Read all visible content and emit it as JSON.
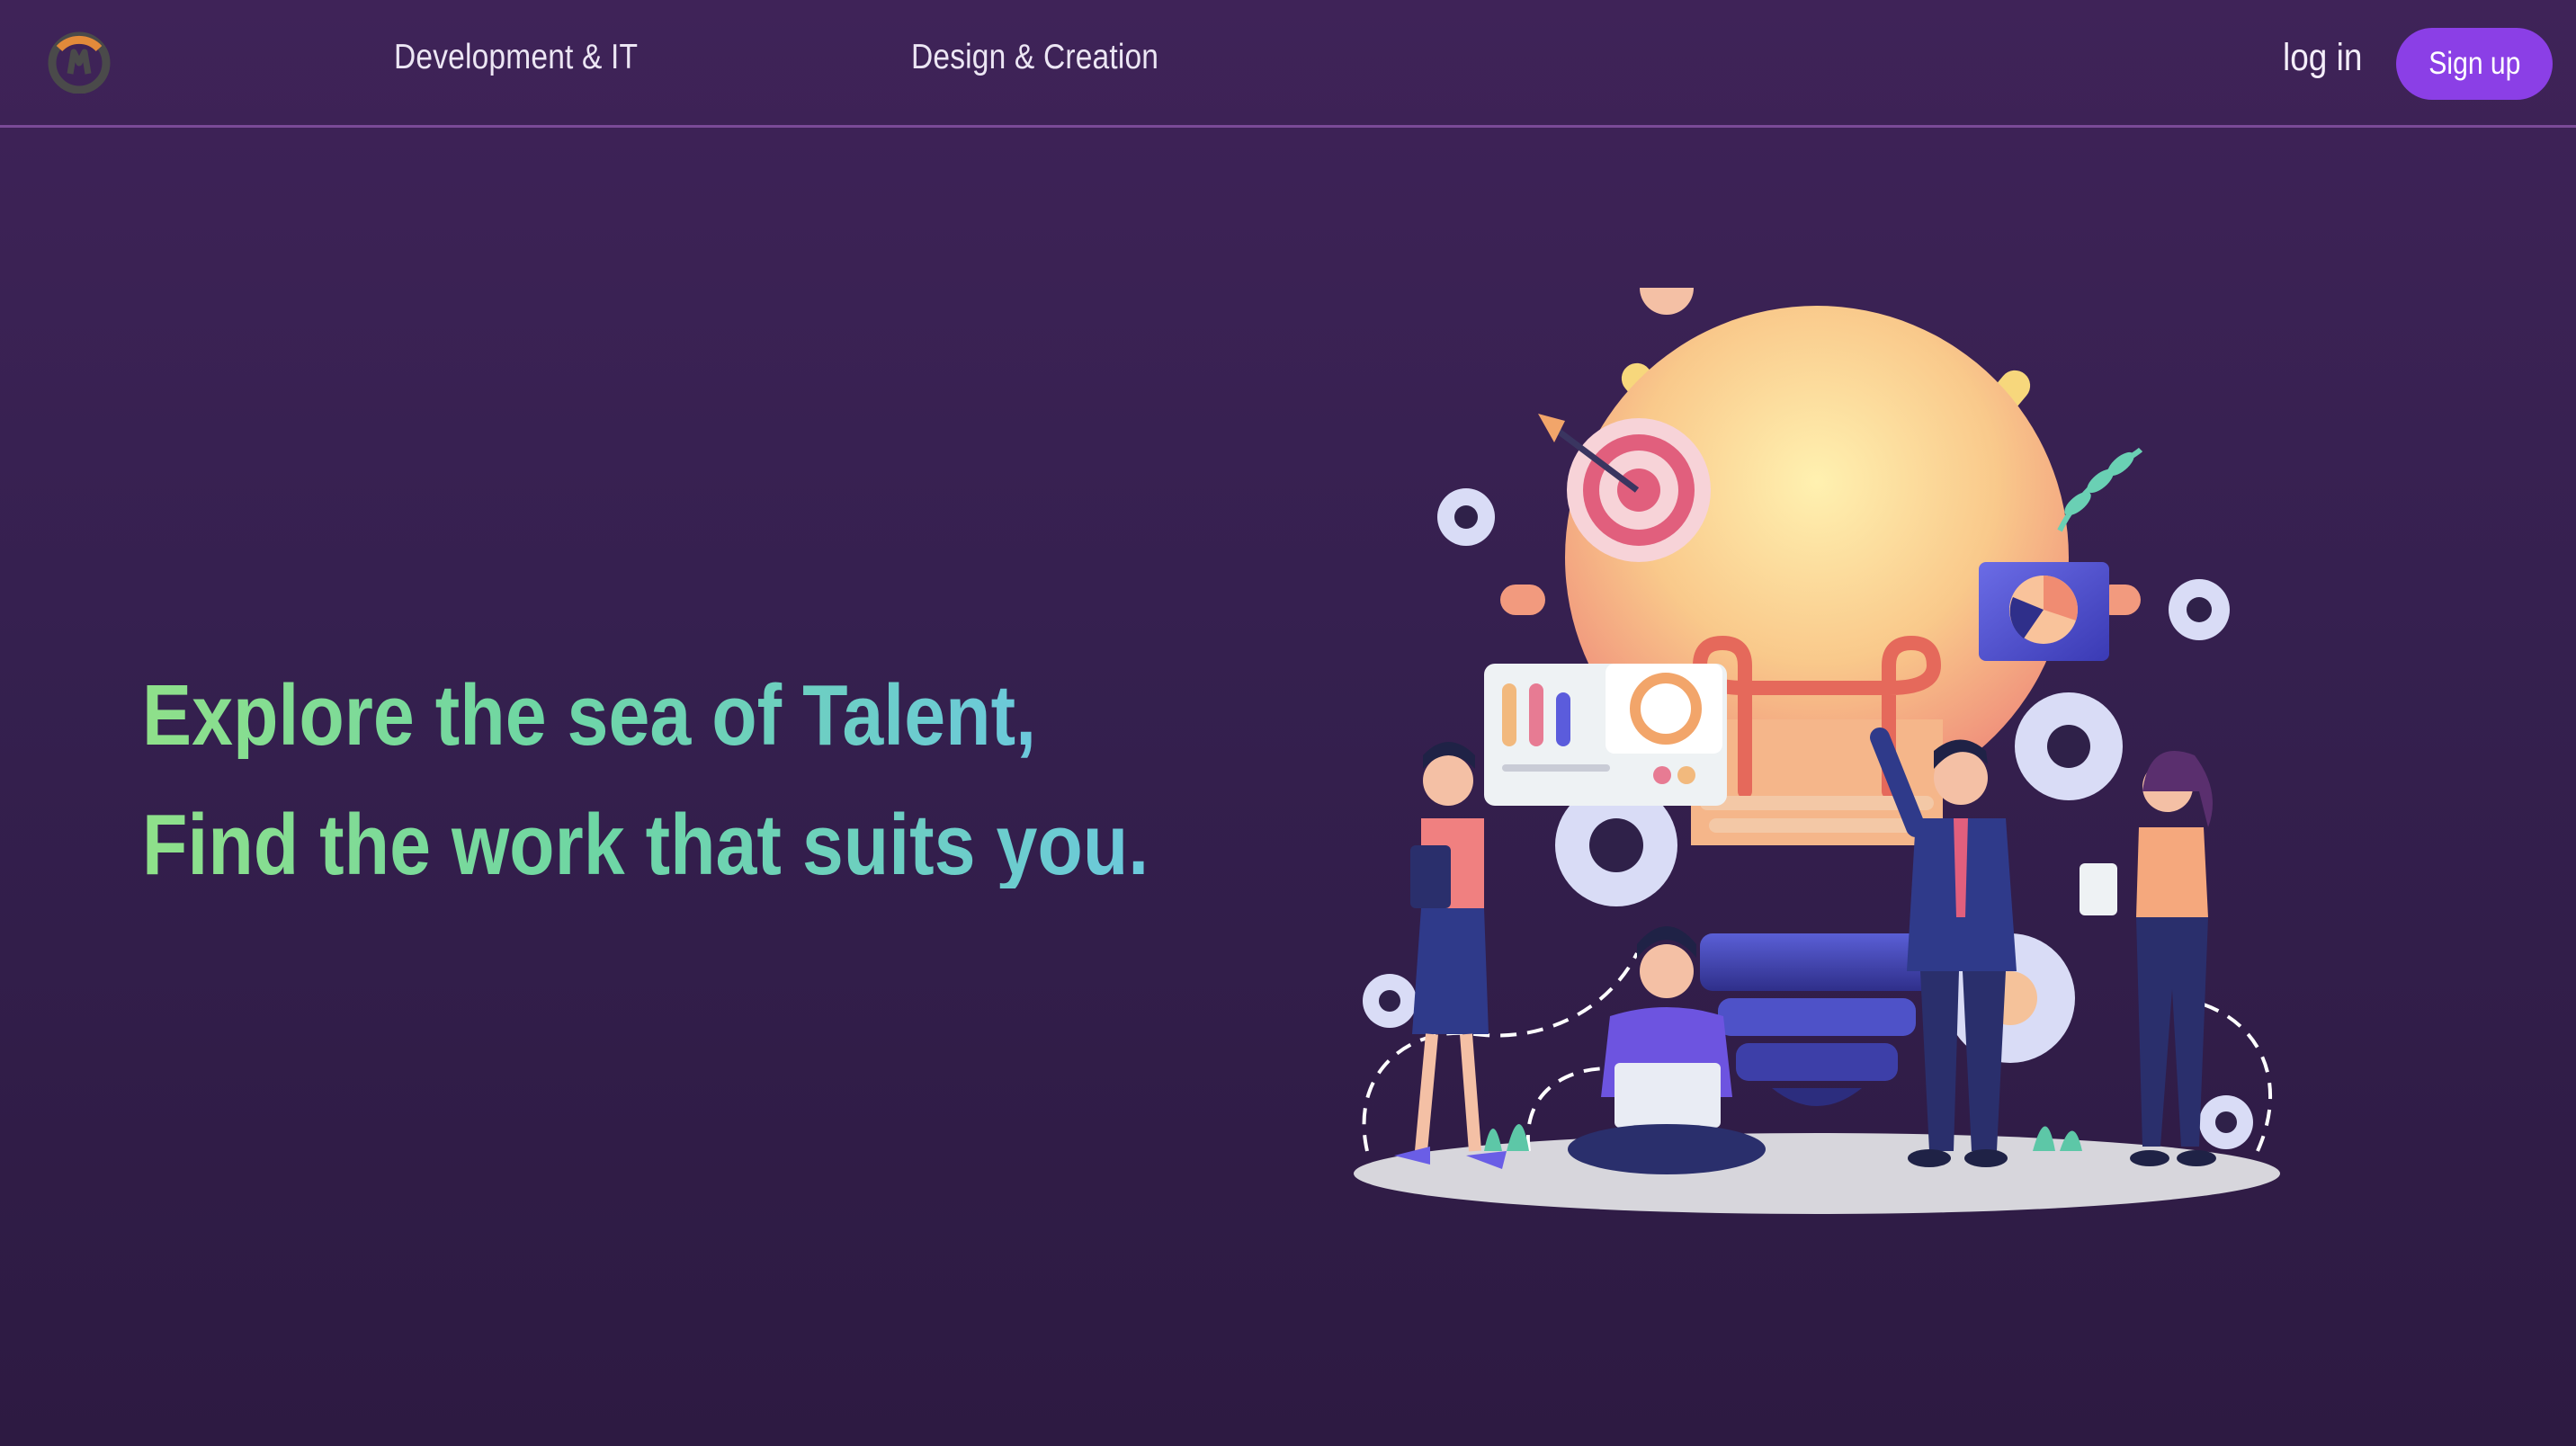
{
  "header": {
    "logo_icon": "overwatch-style-logo-icon",
    "nav_links": [
      {
        "label": "Development & IT"
      },
      {
        "label": "Design & Creation"
      }
    ],
    "login_label": "log in",
    "signup_label": "Sign up"
  },
  "hero": {
    "line1": "Explore the sea of Talent,",
    "line2": "Find the work that suits you."
  },
  "illustration": {
    "icon": "team-ideas-lightbulb-illustration"
  },
  "colors": {
    "background": "#3a2152",
    "accent": "#8b3fe6",
    "headline_gradient_start": "#8fe08a",
    "headline_gradient_end": "#6cc9dc"
  }
}
